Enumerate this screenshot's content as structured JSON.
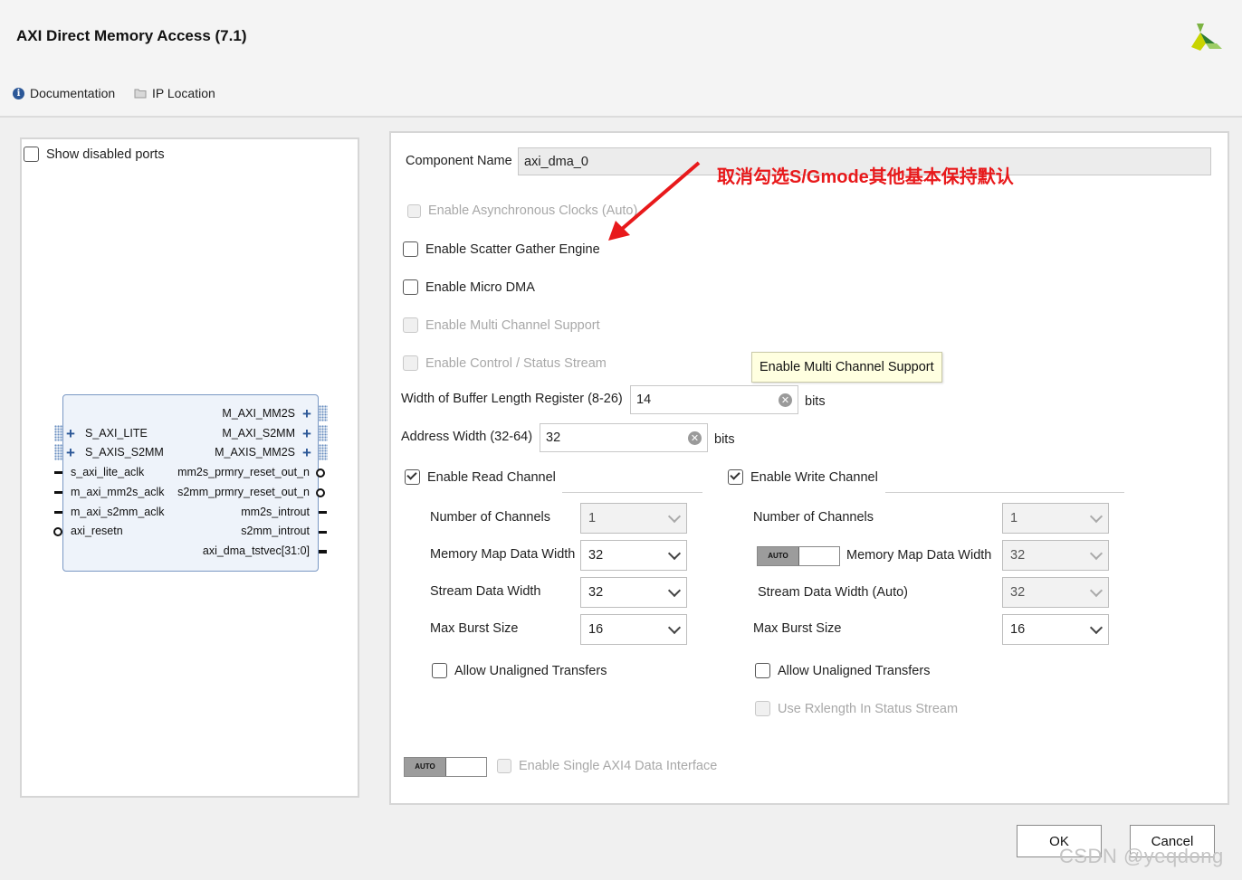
{
  "window": {
    "title": "AXI Direct Memory Access (7.1)"
  },
  "toolbar": {
    "documentation": "Documentation",
    "ip_location": "IP Location"
  },
  "left_panel": {
    "show_disabled_ports": "Show disabled ports",
    "block": {
      "left_bus_ports": [
        "S_AXI_LITE",
        "S_AXIS_S2MM"
      ],
      "left_ports": [
        "s_axi_lite_aclk",
        "m_axi_mm2s_aclk",
        "m_axi_s2mm_aclk",
        "axi_resetn"
      ],
      "right_bus_ports": [
        "M_AXI_MM2S",
        "M_AXI_S2MM",
        "M_AXIS_MM2S"
      ],
      "right_ports": [
        "mm2s_prmry_reset_out_n",
        "s2mm_prmry_reset_out_n",
        "mm2s_introut",
        "s2mm_introut",
        "axi_dma_tstvec[31:0]"
      ]
    }
  },
  "config": {
    "component_name_label": "Component Name",
    "component_name_value": "axi_dma_0",
    "async_clocks": "Enable Asynchronous Clocks (Auto)",
    "scatter_gather": "Enable Scatter Gather Engine",
    "micro_dma": "Enable Micro DMA",
    "multi_channel": "Enable Multi Channel Support",
    "control_status": "Enable Control / Status Stream",
    "buffer_width_label": "Width of Buffer Length Register (8-26)",
    "buffer_width_value": "14",
    "buffer_width_unit": "bits",
    "address_width_label": "Address Width (32-64)",
    "address_width_value": "32",
    "address_width_unit": "bits",
    "read_channel": {
      "label": "Enable Read Channel",
      "num_channels_label": "Number of Channels",
      "num_channels_value": "1",
      "mm_width_label": "Memory Map Data Width",
      "mm_width_value": "32",
      "stream_width_label": "Stream Data Width",
      "stream_width_value": "32",
      "burst_label": "Max Burst Size",
      "burst_value": "16",
      "unaligned_label": "Allow Unaligned Transfers"
    },
    "write_channel": {
      "label": "Enable Write Channel",
      "num_channels_label": "Number of Channels",
      "num_channels_value": "1",
      "mm_width_label": "Memory Map Data Width",
      "mm_width_value": "32",
      "stream_width_label": "Stream Data Width (Auto)",
      "stream_width_value": "32",
      "burst_label": "Max Burst Size",
      "burst_value": "16",
      "unaligned_label": "Allow Unaligned Transfers",
      "rxlength_label": "Use Rxlength In Status Stream"
    },
    "auto_label": "AUTO",
    "single_axi4": "Enable Single AXI4 Data Interface"
  },
  "tooltip": "Enable Multi Channel Support",
  "annotation": "取消勾选S/Gmode其他基本保持默认",
  "buttons": {
    "ok": "OK",
    "cancel": "Cancel"
  },
  "watermark": "CSDN @yeqdong",
  "colors": {
    "annotation_red": "#e8191b",
    "logo_green": "#8dbb3c",
    "block_border": "#7a98c4"
  }
}
